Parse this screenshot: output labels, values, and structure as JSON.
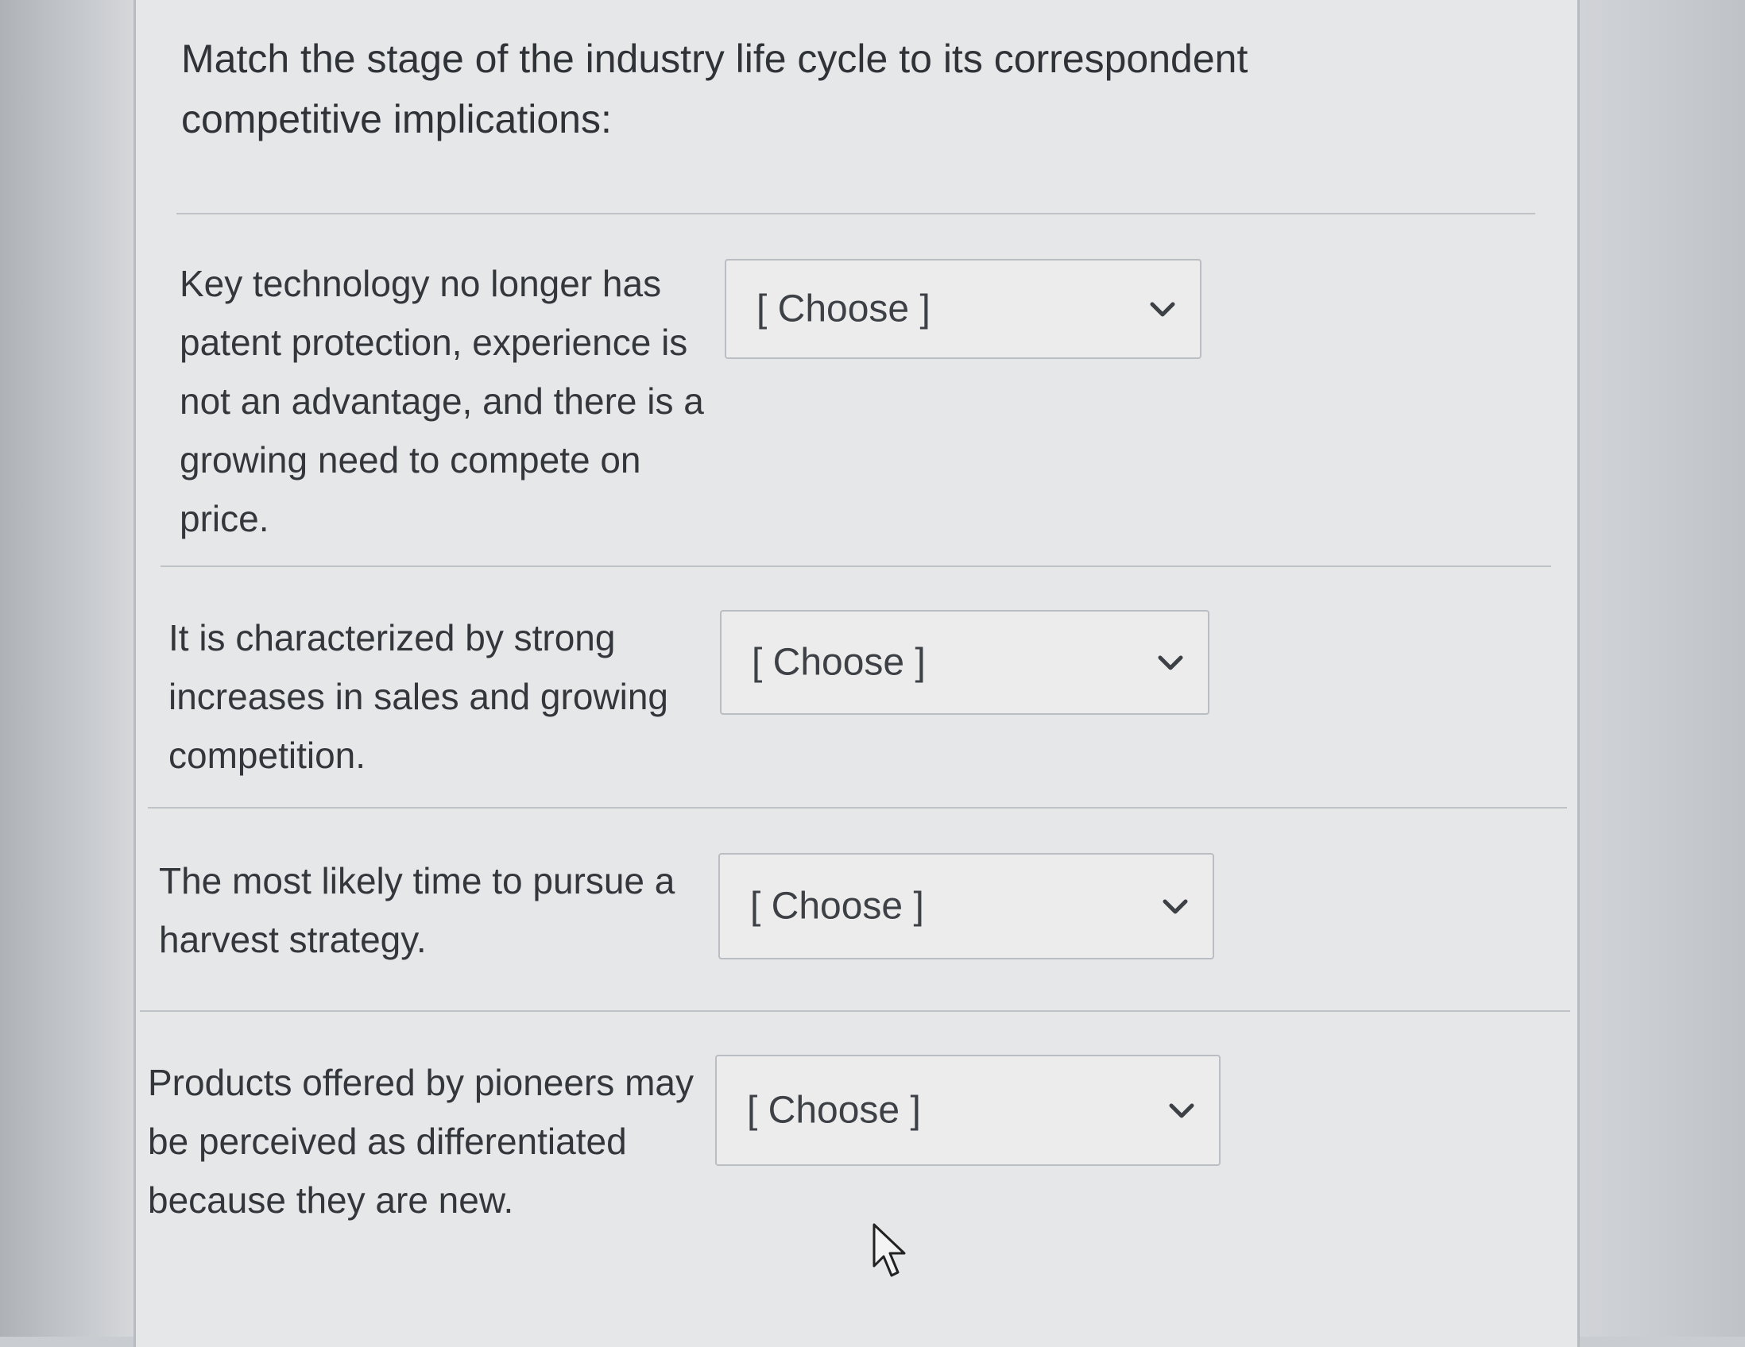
{
  "question": {
    "title": "Match the stage of the industry life cycle to its correspondent competitive implications:"
  },
  "matches": [
    {
      "prompt": "Key technology no longer has patent protection, experience is not an advantage, and there is a growing need to compete on price.",
      "selected": "[ Choose ]"
    },
    {
      "prompt": "It is characterized by strong increases in sales and growing competition.",
      "selected": "[ Choose ]"
    },
    {
      "prompt": "The most likely time to pursue a harvest strategy.",
      "selected": "[ Choose ]"
    },
    {
      "prompt": "Products offered by pioneers may be perceived as differentiated because they are new.",
      "selected": "[ Choose ]"
    }
  ],
  "icons": {
    "dropdown": "chevron-down-icon",
    "pointer": "mouse-pointer-icon"
  },
  "colors": {
    "text": "#2f3337",
    "card": "#e6e7e9",
    "border": "#babdc1"
  }
}
